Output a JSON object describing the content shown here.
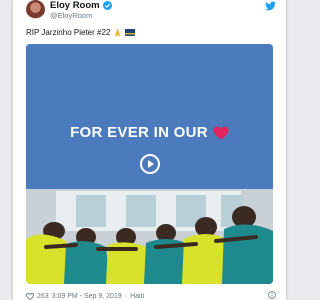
{
  "author": {
    "name": "Eloy Room",
    "handle": "@EloyRoom"
  },
  "tweet": {
    "text": "RIP Jarzinho Pieter #22"
  },
  "media": {
    "caption": "FOR EVER IN OUR"
  },
  "footer": {
    "likes": "263",
    "time": "3:09 PM - Sep 9, 2019",
    "separator": "·",
    "location": "Haiti"
  },
  "colors": {
    "twitter_blue": "#1da1f2",
    "video_blue": "#4b7bbd",
    "heart_red": "#e0245e"
  },
  "icons": {
    "verified": "verified-badge-icon",
    "brand": "twitter-bird-icon",
    "prayer": "folded-hands-emoji",
    "flag": "flag-emoji",
    "caption_heart": "red-heart-emoji",
    "play": "play-icon",
    "like": "heart-icon",
    "info": "info-icon"
  }
}
